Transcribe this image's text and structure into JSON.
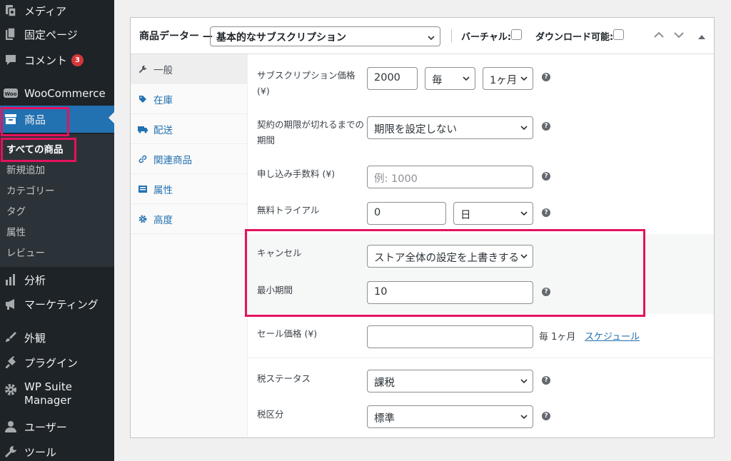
{
  "sidebar": {
    "items": [
      {
        "label": "メディア",
        "icon": "media-icon"
      },
      {
        "label": "固定ページ",
        "icon": "page-icon"
      },
      {
        "label": "コメント",
        "icon": "comment-icon",
        "badge": "3"
      },
      {
        "label": "WooCommerce",
        "icon": "woocommerce-icon"
      },
      {
        "label": "商品",
        "icon": "archive-icon"
      },
      {
        "label": "分析",
        "icon": "bar-chart-icon"
      },
      {
        "label": "マーケティング",
        "icon": "megaphone-icon"
      },
      {
        "label": "外観",
        "icon": "brush-icon"
      },
      {
        "label": "プラグイン",
        "icon": "plugin-icon"
      },
      {
        "label": "WP Suite",
        "label2": "Manager",
        "icon": "gear-icon"
      },
      {
        "label": "ユーザー",
        "icon": "user-icon"
      },
      {
        "label": "ツール",
        "icon": "wrench-icon"
      }
    ],
    "submenu": [
      "すべての商品",
      "新規追加",
      "カテゴリー",
      "タグ",
      "属性",
      "レビュー"
    ]
  },
  "panel": {
    "title": "商品データー",
    "dash": "—",
    "product_type": "基本的なサブスクリプション",
    "virtual_label": "バーチャル:",
    "downloadable_label": "ダウンロード可能:"
  },
  "tabs": [
    {
      "label": "一般",
      "icon": "wrench-icon"
    },
    {
      "label": "在庫",
      "icon": "tag-icon"
    },
    {
      "label": "配送",
      "icon": "truck-icon"
    },
    {
      "label": "関連商品",
      "icon": "link-icon"
    },
    {
      "label": "属性",
      "icon": "list-icon"
    },
    {
      "label": "高度",
      "icon": "gear-icon"
    }
  ],
  "form": {
    "price_label": "サブスクリプション価格",
    "price_label2": "(¥)",
    "price_value": "2000",
    "period_every": "毎",
    "period_length": "1ヶ月",
    "expire_label": "契約の期限が切れるまでの",
    "expire_label2": "期間",
    "expire_value": "期限を設定しない",
    "signup_label": "申し込み手数料 (¥)",
    "signup_placeholder": "例: 1000",
    "trial_label": "無料トライアル",
    "trial_value": "0",
    "trial_unit": "日",
    "cancel_label": "キャンセル",
    "cancel_value": "ストア全体の設定を上書きする",
    "min_label": "最小期間",
    "min_value": "10",
    "sale_label": "セール価格 (¥)",
    "sale_value": "",
    "sale_suffix": "毎 1ヶ月",
    "schedule_link": "スケジュール",
    "tax_status_label": "税ステータス",
    "tax_status_value": "課税",
    "tax_class_label": "税区分",
    "tax_class_value": "標準",
    "help_glyph": "?"
  },
  "colors": {
    "sidebar_bg": "#1d2327",
    "accent": "#2271b1",
    "highlight_border": "#e5125e",
    "badge": "#d63638"
  }
}
